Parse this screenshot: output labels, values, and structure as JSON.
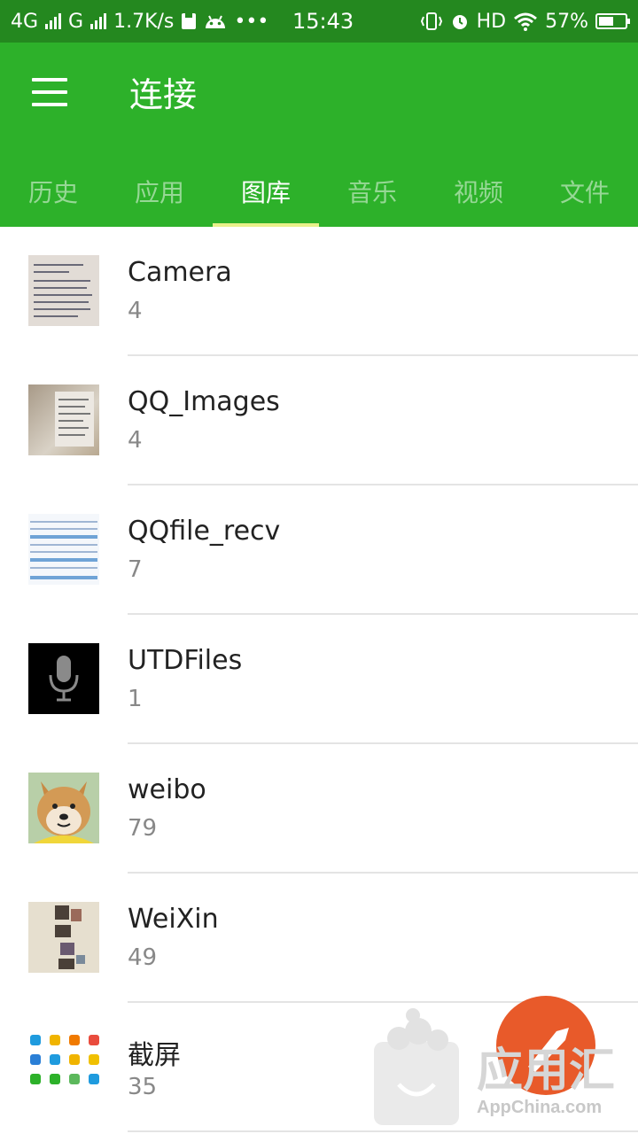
{
  "status_bar": {
    "network1": "4G",
    "network2": "G",
    "speed": "1.7K/s",
    "more": "•••",
    "time": "15:43",
    "hd": "HD",
    "battery_text": "57%",
    "battery_level": 0.57
  },
  "app_bar": {
    "title": "连接",
    "menu_icon": "hamburger-menu-icon"
  },
  "tabs": [
    {
      "label": "历史"
    },
    {
      "label": "应用"
    },
    {
      "label": "图库"
    },
    {
      "label": "音乐"
    },
    {
      "label": "视频"
    },
    {
      "label": "文件"
    }
  ],
  "active_tab": "图库",
  "albums": [
    {
      "name": "Camera",
      "count": "4"
    },
    {
      "name": "QQ_Images",
      "count": "4"
    },
    {
      "name": "QQfile_recv",
      "count": "7"
    },
    {
      "name": "UTDFiles",
      "count": "1"
    },
    {
      "name": "weibo",
      "count": "79"
    },
    {
      "name": "WeiXin",
      "count": "49"
    },
    {
      "name": "截屏",
      "count": "35"
    }
  ],
  "watermark": {
    "cn": "应用汇",
    "en": "AppChina.com"
  },
  "colors": {
    "status_bar": "#24881f",
    "app_bar": "#2db12a",
    "tab_indicator": "#e8f08a",
    "text_primary": "#222222",
    "text_secondary": "#888888"
  }
}
